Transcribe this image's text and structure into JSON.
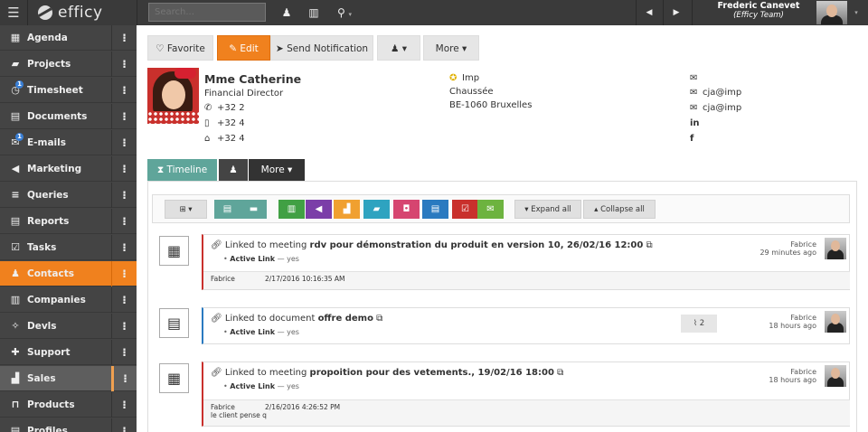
{
  "topbar": {
    "menu_icon": "☰",
    "logo_text": "efficy",
    "search_placeholder": "Search...",
    "user_name": "Frederic Canevet",
    "user_team": "(Efficy Team)"
  },
  "sidebar": {
    "items": [
      {
        "label": "Agenda",
        "icon": "▦",
        "dots": "⁝"
      },
      {
        "label": "Projects",
        "icon": "▰",
        "dots": "⁝"
      },
      {
        "label": "Timesheet",
        "icon": "◷",
        "dots": "⁝",
        "badge": "1"
      },
      {
        "label": "Documents",
        "icon": "▤",
        "dots": "⁝"
      },
      {
        "label": "E-mails",
        "icon": "✉",
        "dots": "⁝",
        "badge": "1"
      },
      {
        "label": "Marketing",
        "icon": "◀",
        "dots": "⁝"
      },
      {
        "label": "Queries",
        "icon": "≡",
        "dots": "⁝"
      },
      {
        "label": "Reports",
        "icon": "▤",
        "dots": "⁝"
      },
      {
        "label": "Tasks",
        "icon": "☑",
        "dots": "⁝"
      },
      {
        "label": "Contacts",
        "icon": "♟",
        "dots": "⁝"
      },
      {
        "label": "Companies",
        "icon": "▥",
        "dots": "⁝"
      },
      {
        "label": "Devls",
        "icon": "✧",
        "dots": "⁝"
      },
      {
        "label": "Support",
        "icon": "✚",
        "dots": "⁝"
      },
      {
        "label": "Sales",
        "icon": "▟",
        "dots": "⁝"
      },
      {
        "label": "Products",
        "icon": "⊓",
        "dots": "⁝"
      },
      {
        "label": "Profiles",
        "icon": "▤",
        "dots": "⁝"
      }
    ]
  },
  "actions": {
    "favorite": "Favorite",
    "edit": "Edit",
    "send_notification": "Send Notification",
    "more": "More"
  },
  "contact": {
    "name": "Mme Catherine",
    "title": "Financial Director",
    "phone": "+32 2",
    "mobile": "+32 4",
    "home": "+32 4",
    "company": "Imp",
    "street": "Chaussée",
    "city": "BE-1060 Bruxelles",
    "email1": "cja@imp",
    "email2": "cja@imp"
  },
  "tabs": {
    "timeline": "Timeline",
    "more": "More"
  },
  "toolbar": {
    "expand": "Expand all",
    "collapse": "Collapse all"
  },
  "colors": {
    "accent": "#f0811e",
    "timeline_tab": "#5fa59a",
    "sq": [
      "#5fa59a",
      "#5fa59a",
      "#41a044",
      "#7b3ea8",
      "#f0a030",
      "#2ea3c0",
      "#d64570",
      "#2a7ac0",
      "#c9302c",
      "#6db33f"
    ]
  },
  "timeline": [
    {
      "kind": "meeting",
      "prefix": "Linked to meeting",
      "title": "rdv pour démonstration du produit en version 10, 26/02/16 12:00",
      "link_label": "Active Link",
      "link_value": "— yes",
      "author": "Fabrice",
      "ago": "29 minutes ago",
      "foot_author": "Fabrice",
      "foot_date": "2/17/2016 10:16:35 AM",
      "foot_note": ""
    },
    {
      "kind": "document",
      "prefix": "Linked to document",
      "title": "offre demo",
      "link_label": "Active Link",
      "link_value": "— yes",
      "author": "Fabrice",
      "ago": "18 hours ago",
      "attachments": "2"
    },
    {
      "kind": "meeting",
      "prefix": "Linked to meeting",
      "title": "propoition pour des vetements., 19/02/16 18:00",
      "link_label": "Active Link",
      "link_value": "— yes",
      "author": "Fabrice",
      "ago": "18 hours ago",
      "foot_author": "Fabrice",
      "foot_date": "2/16/2016 4:26:52 PM",
      "foot_note": "le client pense q"
    }
  ]
}
